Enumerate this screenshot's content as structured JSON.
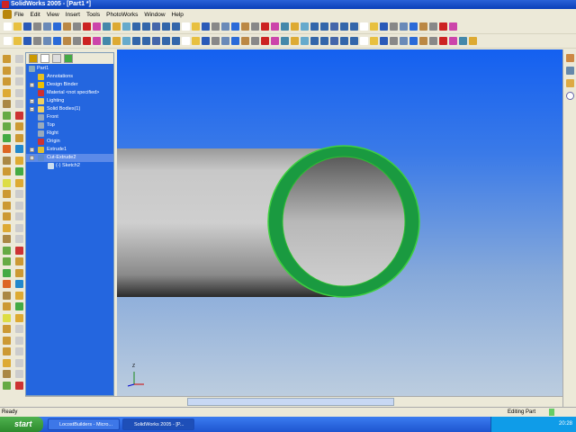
{
  "window": {
    "title": "SolidWorks 2005 - [Part1 *]"
  },
  "menu": [
    "File",
    "Edit",
    "View",
    "Insert",
    "Tools",
    "PhotoWorks",
    "Window",
    "Help"
  ],
  "tree": {
    "root": "Part1",
    "items": [
      {
        "label": "Annotations",
        "expand": false,
        "color": "#e8c020"
      },
      {
        "label": "Design Binder",
        "expand": true,
        "color": "#f0c000"
      },
      {
        "label": "Material <not specified>",
        "expand": false,
        "color": "#d03030"
      },
      {
        "label": "Lighting",
        "expand": true,
        "color": "#f0d060"
      },
      {
        "label": "Solid Bodies(1)",
        "expand": true,
        "color": "#f0d060"
      },
      {
        "label": "Front",
        "expand": false,
        "color": "#9ab"
      },
      {
        "label": "Top",
        "expand": false,
        "color": "#9ab"
      },
      {
        "label": "Right",
        "expand": false,
        "color": "#9ab"
      },
      {
        "label": "Origin",
        "expand": false,
        "color": "#c33"
      },
      {
        "label": "Extrude1",
        "expand": true,
        "color": "#e0c030"
      },
      {
        "label": "Cut-Extrude2",
        "expand": true,
        "color": "#5a8ad0"
      }
    ],
    "child": "(-) Sketch2"
  },
  "status": {
    "left": "Ready",
    "right": "Editing Part"
  },
  "taskbar": {
    "start": "start",
    "buttons": [
      "LocostBuilders - Micro...",
      "SolidWorks 2005 - [P..."
    ],
    "clock": "20:28"
  },
  "triad": {
    "axis": "Z"
  }
}
